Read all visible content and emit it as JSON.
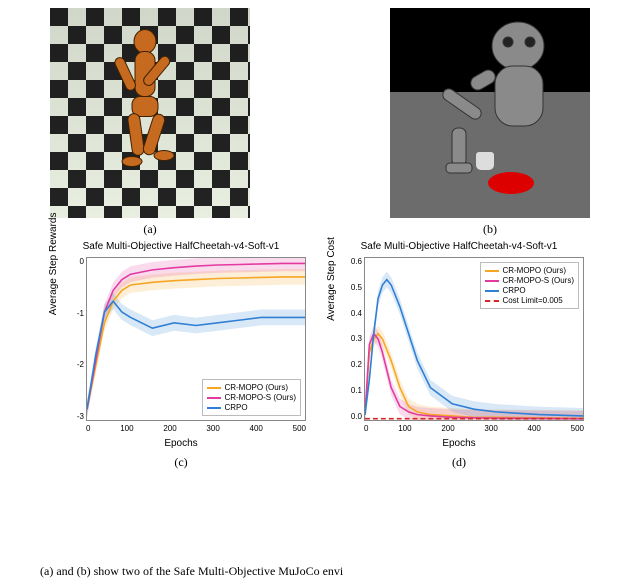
{
  "subcaptions": {
    "a": "(a)",
    "b": "(b)",
    "c": "(c)",
    "d": "(d)"
  },
  "caption_fragment": "    (a) and (b) show two of the Safe Multi-Objective MuJoCo envi",
  "sim_a": {
    "desc": "humanoid-walker"
  },
  "sim_b": {
    "desc": "robot-arm-cup"
  },
  "chart_data": [
    {
      "id": "rewards",
      "type": "line",
      "title": "Safe Multi-Objective HalfCheetah-v4-Soft-v1",
      "xlabel": "Epochs",
      "ylabel": "Average Step Rewards",
      "xlim": [
        0,
        500
      ],
      "ylim": [
        -3,
        0
      ],
      "xticks": [
        0,
        100,
        200,
        300,
        400,
        500
      ],
      "yticks": [
        "0",
        "-1",
        "-2",
        "-3"
      ],
      "legend_pos": "bottom-right",
      "series": [
        {
          "name": "CR-MOPO (Ours)",
          "color": "#f5a623",
          "x": [
            0,
            20,
            40,
            60,
            80,
            100,
            150,
            200,
            250,
            300,
            350,
            400,
            450,
            500
          ],
          "y": [
            -2.8,
            -2.0,
            -1.2,
            -0.8,
            -0.6,
            -0.5,
            -0.45,
            -0.42,
            -0.4,
            -0.38,
            -0.37,
            -0.36,
            -0.35,
            -0.35
          ]
        },
        {
          "name": "CR-MOPO-S (Ours)",
          "color": "#e23aa0",
          "x": [
            0,
            20,
            40,
            60,
            80,
            100,
            150,
            200,
            250,
            300,
            350,
            400,
            450,
            500
          ],
          "y": [
            -2.8,
            -1.9,
            -1.0,
            -0.6,
            -0.4,
            -0.3,
            -0.22,
            -0.18,
            -0.15,
            -0.13,
            -0.12,
            -0.11,
            -0.1,
            -0.1
          ]
        },
        {
          "name": "CRPO",
          "color": "#2f7fd4",
          "x": [
            0,
            20,
            40,
            60,
            80,
            100,
            150,
            200,
            250,
            300,
            350,
            400,
            450,
            500
          ],
          "y": [
            -2.8,
            -1.8,
            -1.0,
            -0.8,
            -1.0,
            -1.1,
            -1.3,
            -1.2,
            -1.25,
            -1.2,
            -1.15,
            -1.1,
            -1.1,
            -1.1
          ]
        }
      ]
    },
    {
      "id": "cost",
      "type": "line",
      "title": "Safe Multi-Objective HalfCheetah-v4-Soft-v1",
      "xlabel": "Epochs",
      "ylabel": "Average Step Cost",
      "xlim": [
        0,
        500
      ],
      "ylim": [
        0,
        0.6
      ],
      "xticks": [
        0,
        100,
        200,
        300,
        400,
        500
      ],
      "yticks": [
        "0.6",
        "0.5",
        "0.4",
        "0.3",
        "0.2",
        "0.1",
        "0.0"
      ],
      "legend_pos": "top-right",
      "cost_limit": 0.005,
      "series": [
        {
          "name": "CR-MOPO (Ours)",
          "color": "#f5a623",
          "x": [
            0,
            10,
            20,
            30,
            40,
            60,
            80,
            100,
            120,
            150,
            200,
            250,
            300,
            400,
            500
          ],
          "y": [
            0.02,
            0.25,
            0.3,
            0.32,
            0.3,
            0.22,
            0.12,
            0.05,
            0.03,
            0.02,
            0.015,
            0.01,
            0.01,
            0.008,
            0.006
          ]
        },
        {
          "name": "CR-MOPO-S (Ours)",
          "color": "#e23aa0",
          "x": [
            0,
            10,
            20,
            30,
            40,
            60,
            80,
            100,
            120,
            150,
            200,
            250,
            300,
            400,
            500
          ],
          "y": [
            0.02,
            0.28,
            0.32,
            0.3,
            0.25,
            0.12,
            0.05,
            0.03,
            0.02,
            0.015,
            0.01,
            0.008,
            0.007,
            0.006,
            0.005
          ]
        },
        {
          "name": "CRPO",
          "color": "#2f7fd4",
          "x": [
            0,
            10,
            20,
            30,
            40,
            50,
            60,
            80,
            100,
            120,
            150,
            200,
            250,
            300,
            400,
            500
          ],
          "y": [
            0.02,
            0.15,
            0.32,
            0.45,
            0.5,
            0.52,
            0.5,
            0.42,
            0.32,
            0.22,
            0.12,
            0.06,
            0.04,
            0.03,
            0.02,
            0.015
          ]
        },
        {
          "name": "Cost Limit=0.005",
          "color": "#d62728",
          "dash": true,
          "x": [
            0,
            500
          ],
          "y": [
            0.005,
            0.005
          ]
        }
      ]
    }
  ]
}
